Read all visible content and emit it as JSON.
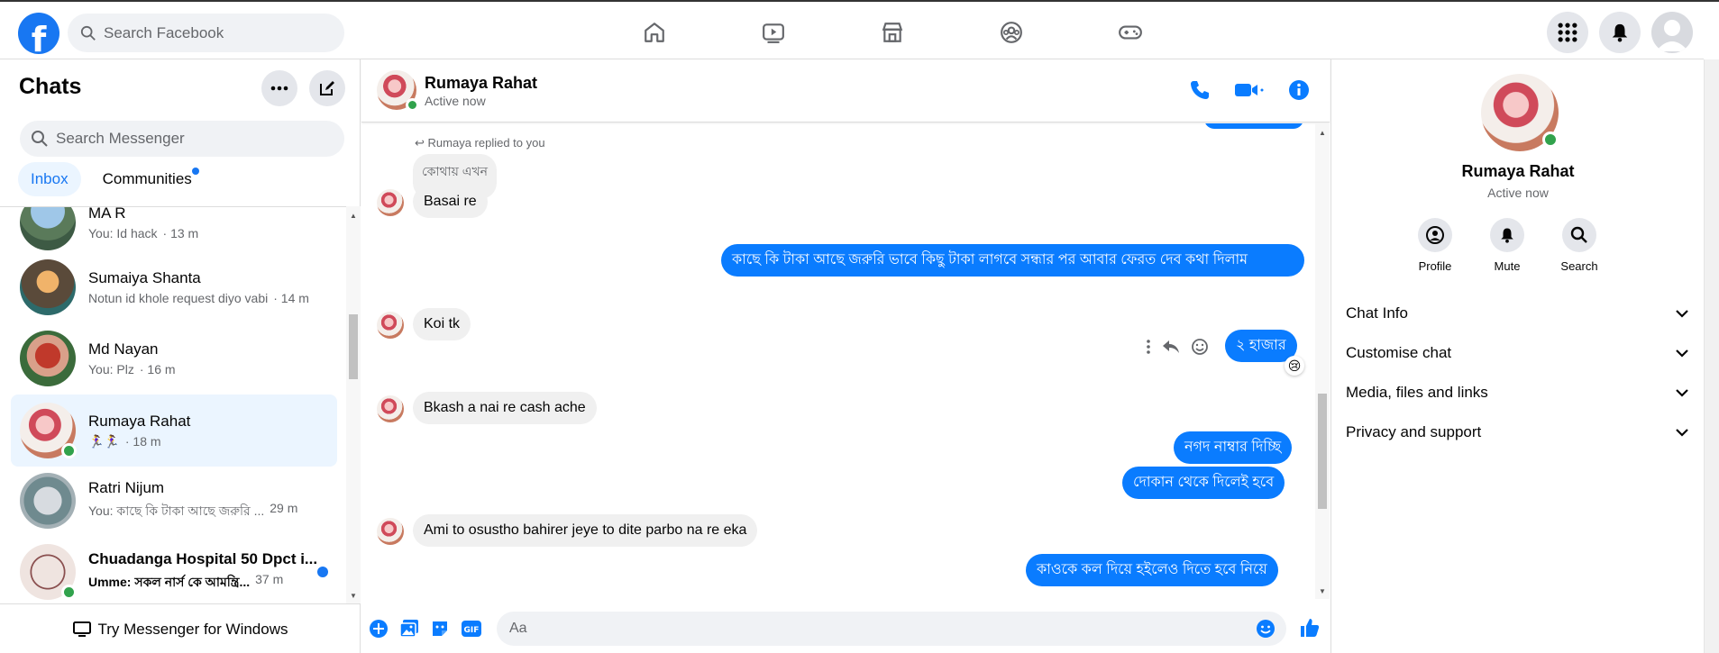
{
  "topbar": {
    "logo": "f",
    "search_placeholder": "Search Facebook",
    "nav_icons": [
      "home-icon",
      "watch-icon",
      "marketplace-icon",
      "groups-icon",
      "gaming-icon"
    ]
  },
  "left": {
    "title": "Chats",
    "search_placeholder": "Search Messenger",
    "tabs": [
      {
        "label": "Inbox",
        "active": true
      },
      {
        "label": "Communities",
        "active": false
      }
    ],
    "items": [
      {
        "name": "MA R",
        "sub": "You: Id hack",
        "time": "· 13 m",
        "unread": false,
        "online": false,
        "selected": false
      },
      {
        "name": "Sumaiya Shanta",
        "sub": "Notun id khole request diyo vabi",
        "time": "· 14 m",
        "unread": false,
        "online": false,
        "selected": false
      },
      {
        "name": "Md Nayan",
        "sub": "You: Plz",
        "time": "· 16 m",
        "unread": false,
        "online": false,
        "selected": false
      },
      {
        "name": "Rumaya Rahat",
        "sub": "🏃‍♀️🏃‍♀️",
        "time": "· 18 m",
        "unread": false,
        "online": true,
        "selected": true
      },
      {
        "name": "Ratri Nijum",
        "sub": "You: কাছে কি টাকা আছে জরুরি ...",
        "time": "29 m",
        "unread": false,
        "online": false,
        "selected": false
      },
      {
        "name": "Chuadanga Hospital 50 Dpct i...",
        "sub": "Umme: সকল নার্স কে আমন্ত্রি...",
        "time": "37 m",
        "unread": true,
        "online": true,
        "selected": false
      }
    ],
    "footer": "Try Messenger for Windows"
  },
  "chat": {
    "name": "Rumaya Rahat",
    "status": "Active now",
    "replied_label": "Rumaya replied to you",
    "quoted": "কোথায় এখন",
    "messages": [
      {
        "dir": "in",
        "text": "Basai re"
      },
      {
        "dir": "out",
        "text": "কাছে কি টাকা আছে জরুরি ভাবে কিছু টাকা লাগবে সন্ধার পর আবার ফেরত দেব কথা দিলাম"
      },
      {
        "dir": "in",
        "text": "Koi tk"
      },
      {
        "dir": "out",
        "text": "২ হাজার",
        "reaction": "😢"
      },
      {
        "dir": "in",
        "text": "Bkash a nai re cash ache"
      },
      {
        "dir": "out",
        "text": "নগদ নাম্বার দিচ্ছি"
      },
      {
        "dir": "out",
        "text": "দোকান থেকে দিলেই হবে"
      },
      {
        "dir": "in",
        "text": "Ami to osustho bahirer jeye to dite parbo na re eka"
      },
      {
        "dir": "out",
        "text": "কাওকে কল দিয়ে হইলেও দিতে হবে নিয়ে"
      }
    ],
    "composer_placeholder": "Aa"
  },
  "right": {
    "name": "Rumaya Rahat",
    "status": "Active now",
    "actions": [
      {
        "label": "Profile",
        "icon": "profile-icon"
      },
      {
        "label": "Mute",
        "icon": "bell-icon"
      },
      {
        "label": "Search",
        "icon": "search-icon"
      }
    ],
    "sections": [
      "Chat Info",
      "Customise chat",
      "Media, files and links",
      "Privacy and support"
    ]
  },
  "colors": {
    "accent": "#0a7cff",
    "brand": "#1877f2",
    "online": "#31a24c"
  }
}
